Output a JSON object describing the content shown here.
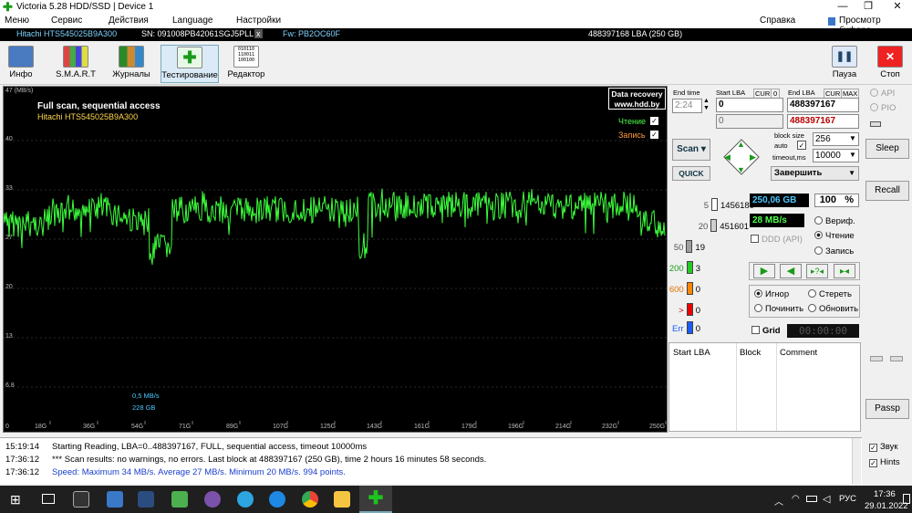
{
  "window": {
    "title": "Victoria 5.28 HDD/SSD | Device 1"
  },
  "menu": {
    "items": [
      "Меню",
      "Сервис",
      "Действия",
      "Language",
      "Настройки"
    ],
    "help": "Справка",
    "buffer": "Просмотр буфера"
  },
  "device": {
    "model": "Hitachi HTS545025B9A300",
    "serial": "SN: 091008PB42061SGJ5PLL",
    "close": "x",
    "firmware": "Fw: PB2OC60F",
    "capacity": "488397168 LBA (250 GB)"
  },
  "toolbar": {
    "info": "Инфо",
    "smart": "S.M.A.R.T",
    "logs": "Журналы",
    "test": "Тестирование",
    "editor": "Редактор",
    "pause": "Пауза",
    "stop": "Стоп"
  },
  "graph": {
    "title": "Full scan, sequential access",
    "subtitle": "Hitachi HTS545025B9A300",
    "unit": "47 (MB/s)",
    "yticks": [
      "40",
      "33",
      "27",
      "20",
      "13",
      "6.8",
      "0"
    ],
    "xticks": [
      "18G",
      "36G",
      "54G",
      "71G",
      "89G",
      "107G",
      "125G",
      "143G",
      "161G",
      "179G",
      "196G",
      "214G",
      "232G",
      "250G"
    ],
    "badge1": "Data recovery",
    "badge2": "www.hdd.by",
    "legend_read": "Чтение",
    "legend_write": "Запись",
    "note_speed": "0,5 MB/s",
    "note_size": "228 GB",
    "line_color": "#3cff3c"
  },
  "controls": {
    "end_time_label": "End time",
    "end_time": "2:24",
    "start_lba_label": "Start LBA",
    "cur": "CUR",
    "zero": "0",
    "end_lba_label": "End LBA",
    "max": "MAX",
    "start_lba": "0",
    "start_lba2": "0",
    "end_lba": "488397167",
    "end_lba2": "488397167",
    "block_size_label": "block size",
    "auto_label": "auto",
    "timeout_label": "timeout,ms",
    "block_size": "256",
    "timeout": "10000",
    "scan": "Scan",
    "quick": "QUICK",
    "finish": "Завершить",
    "counts": [
      {
        "label": "5",
        "value": "1456180",
        "color": "#ffffff"
      },
      {
        "label": "20",
        "value": "451601",
        "color": "#d0d0d0"
      },
      {
        "label": "50",
        "value": "19",
        "color": "#a0a0a0"
      },
      {
        "label": "200",
        "value": "3",
        "color": "#22cc22"
      },
      {
        "label": "600",
        "value": "0",
        "color": "#ff8800"
      },
      {
        "label": ">",
        "value": "0",
        "color": "#ee0000"
      },
      {
        "label": "Err",
        "value": "0",
        "color": "#1a5cff"
      }
    ],
    "total": "250,06 GB",
    "percent": "100",
    "pct_sign": "%",
    "speed": "28 MB/s",
    "ddd": "DDD (API)",
    "verify": "Вериф.",
    "read": "Чтение",
    "write": "Запись",
    "ignore": "Игнор",
    "erase": "Стереть",
    "repair": "Починить",
    "refresh": "Обновить",
    "grid": "Grid",
    "timer": "00:00:00",
    "table_headers": [
      "Start LBA",
      "Block",
      "Comment"
    ]
  },
  "side": {
    "api": "API",
    "pio": "PIO",
    "sleep": "Sleep",
    "recall": "Recall",
    "passp": "Passp"
  },
  "log": [
    {
      "time": "15:19:14",
      "msg": "Starting Reading, LBA=0..488397167, FULL, sequential access, timeout 10000ms",
      "color": "#000"
    },
    {
      "time": "17:36:12",
      "msg": "*** Scan results: no warnings, no errors. Last block at 488397167 (250 GB), time 2 hours 16 minutes 58 seconds.",
      "color": "#000"
    },
    {
      "time": "17:36:12",
      "msg": "Speed: Maximum 34 MB/s. Average 27 MB/s. Minimum 20 MB/s. 994 points.",
      "color": "#1a3fcc"
    }
  ],
  "logside": {
    "sound": "Звук",
    "hints": "Hints"
  },
  "taskbar": {
    "lang": "РУС",
    "time": "17:36",
    "date": "29.01.2022"
  }
}
